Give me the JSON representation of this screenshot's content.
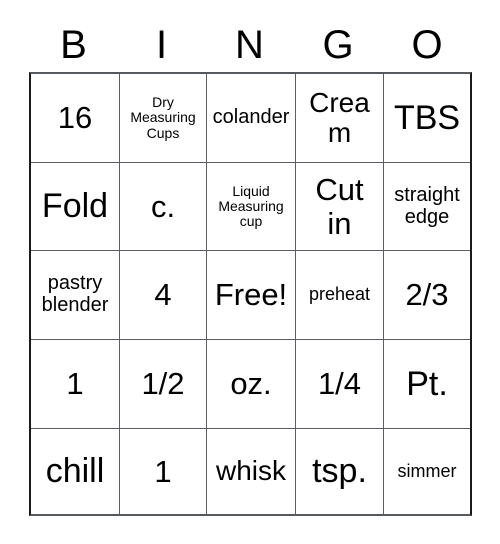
{
  "card": {
    "title": "BINGO",
    "headers": [
      "B",
      "I",
      "N",
      "G",
      "O"
    ],
    "free_space_label": "Free!",
    "colors": {
      "background": "#ffffff",
      "text": "#000000",
      "grid_line": "#5a5f63",
      "outer_border": "#1a1a1a"
    },
    "rows": [
      [
        {
          "text": "16",
          "size": "xl"
        },
        {
          "text": "Dry\nMeasuring\nCups",
          "size": "xxs"
        },
        {
          "text": "colander",
          "size": "s"
        },
        {
          "text": "Cream",
          "size": "l"
        },
        {
          "text": "TBS",
          "size": "xxl"
        }
      ],
      [
        {
          "text": "Fold",
          "size": "xxl"
        },
        {
          "text": "c.",
          "size": "xl"
        },
        {
          "text": "Liquid\nMeasuring\ncup",
          "size": "xxs"
        },
        {
          "text": "Cut\nin",
          "size": "xl"
        },
        {
          "text": "straight\nedge",
          "size": "s"
        }
      ],
      [
        {
          "text": "pastry\nblender",
          "size": "s"
        },
        {
          "text": "4",
          "size": "xl"
        },
        {
          "text": "Free!",
          "size": "xl"
        },
        {
          "text": "preheat",
          "size": "xs"
        },
        {
          "text": "2/3",
          "size": "xl"
        }
      ],
      [
        {
          "text": "1",
          "size": "xl"
        },
        {
          "text": "1/2",
          "size": "xl"
        },
        {
          "text": "oz.",
          "size": "xl"
        },
        {
          "text": "1/4",
          "size": "xl"
        },
        {
          "text": "Pt.",
          "size": "xxl"
        }
      ],
      [
        {
          "text": "chill",
          "size": "xxl"
        },
        {
          "text": "1",
          "size": "xl"
        },
        {
          "text": "whisk",
          "size": "l"
        },
        {
          "text": "tsp.",
          "size": "xxl"
        },
        {
          "text": "simmer",
          "size": "xs"
        }
      ]
    ]
  }
}
